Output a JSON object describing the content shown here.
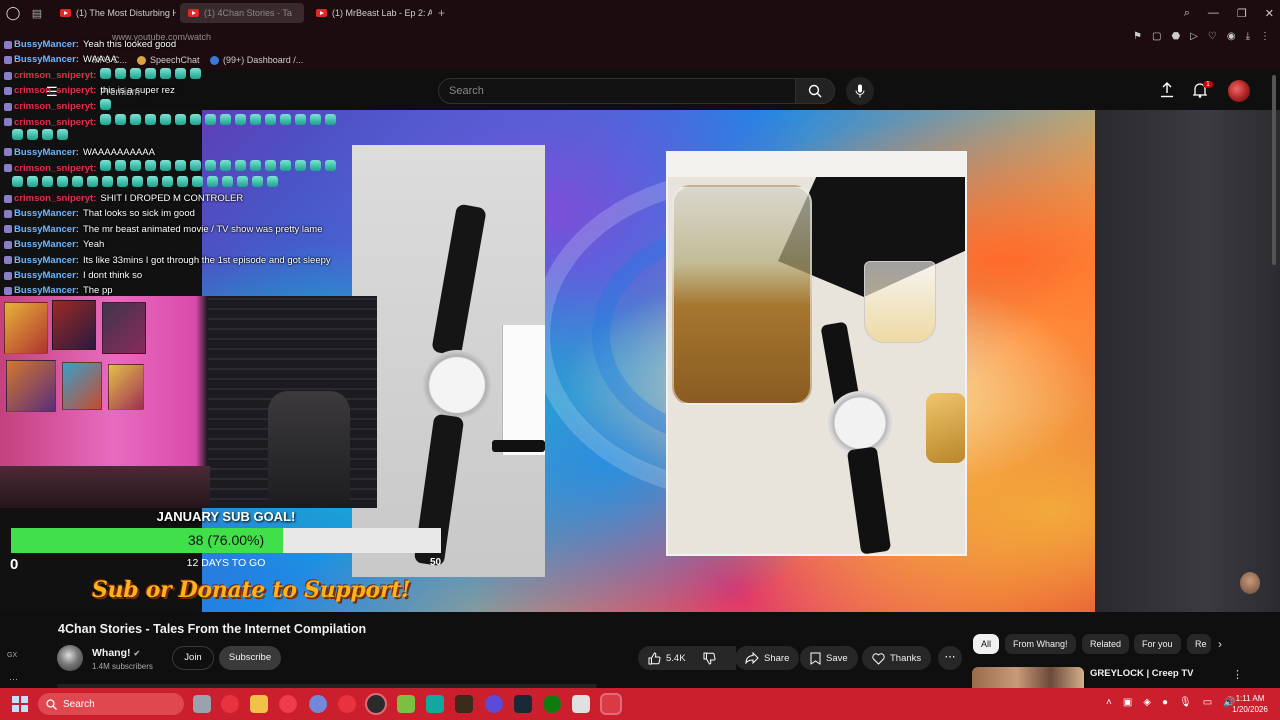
{
  "browser": {
    "tabs": [
      {
        "label": "(1) The Most Disturbing H"
      },
      {
        "label": "(1) 4Chan Stories - Ta"
      },
      {
        "label": "(1) MrBeast Lab - Ep 2: A"
      }
    ],
    "newtab_label": "+",
    "url": "www.youtube.com/watch",
    "bookmarks": [
      {
        "label": "MP3 C..."
      },
      {
        "label": "SpeechChat"
      },
      {
        "label": "(99+) Dashboard /..."
      }
    ]
  },
  "yt_header": {
    "premium_label": "Premium",
    "search_placeholder": "Search",
    "notification_count": "1"
  },
  "overlay": {
    "chat": [
      {
        "user": "BussyMancer",
        "message": "Yeah this looked good",
        "emotes": 0
      },
      {
        "user": "BussyMancer",
        "message": "WAAAA",
        "emotes": 0
      },
      {
        "user": "crimson_sniperyt",
        "message": "",
        "emotes": 7
      },
      {
        "user": "crimson_sniperyt",
        "message": "this is a super rez",
        "emotes": 0
      },
      {
        "user": "crimson_sniperyt",
        "message": "",
        "emotes": 1
      },
      {
        "user": "crimson_sniperyt",
        "message": "",
        "emotes": 16
      },
      {
        "user": "",
        "message": "",
        "emotes": 4
      },
      {
        "user": "BussyMancer",
        "message": "WAAAAAAAAAA",
        "emotes": 0
      },
      {
        "user": "crimson_sniperyt",
        "message": "",
        "emotes": 16
      },
      {
        "user": "",
        "message": "",
        "emotes": 18
      },
      {
        "user": "crimson_sniperyt",
        "message": "SHIT I DROPED M CONTROLER",
        "emotes": 0
      },
      {
        "user": "BussyMancer",
        "message": "That looks so sick im good",
        "emotes": 0
      },
      {
        "user": "BussyMancer",
        "message": "The mr beast animated movie / TV show was pretty lame",
        "emotes": 0
      },
      {
        "user": "BussyMancer",
        "message": "Yeah",
        "emotes": 0
      },
      {
        "user": "BussyMancer",
        "message": "Its like 33mins I got through the 1st episode and got sleepy",
        "emotes": 0
      },
      {
        "user": "BussyMancer",
        "message": "I dont think so",
        "emotes": 0
      },
      {
        "user": "BussyMancer",
        "message": "The pp",
        "emotes": 0
      }
    ],
    "goal": {
      "title": "JANUARY SUB GOAL!",
      "progress_text": "38 (76.00%)",
      "progress_fraction": 0.76,
      "min_label": "0",
      "max_label": "50",
      "days_text": "12 DAYS TO GO"
    },
    "support_text": "Sub or Donate to Support!"
  },
  "video": {
    "title": "4Chan Stories - Tales From the Internet Compilation",
    "channel_name": "Whang!",
    "subscribers": "1.4M subscribers",
    "join_label": "Join",
    "subscribe_label": "Subscribe",
    "like_count": "5.4K",
    "share_label": "Share",
    "save_label": "Save",
    "thanks_label": "Thanks",
    "more_label": "⋯"
  },
  "sidebar": {
    "chips": [
      "All",
      "From Whang!",
      "Related",
      "For you",
      "Re"
    ],
    "recommendation_title": "GREYLOCK | Creep TV",
    "rail_label": "GX"
  },
  "taskbar": {
    "search_placeholder": "Search",
    "time": "1:11 AM",
    "date": "1/20/2026"
  },
  "colors": {
    "taskbar": "#cc1f2d",
    "goal_fill": "#41e04a",
    "support_text": "#ffb31a"
  }
}
